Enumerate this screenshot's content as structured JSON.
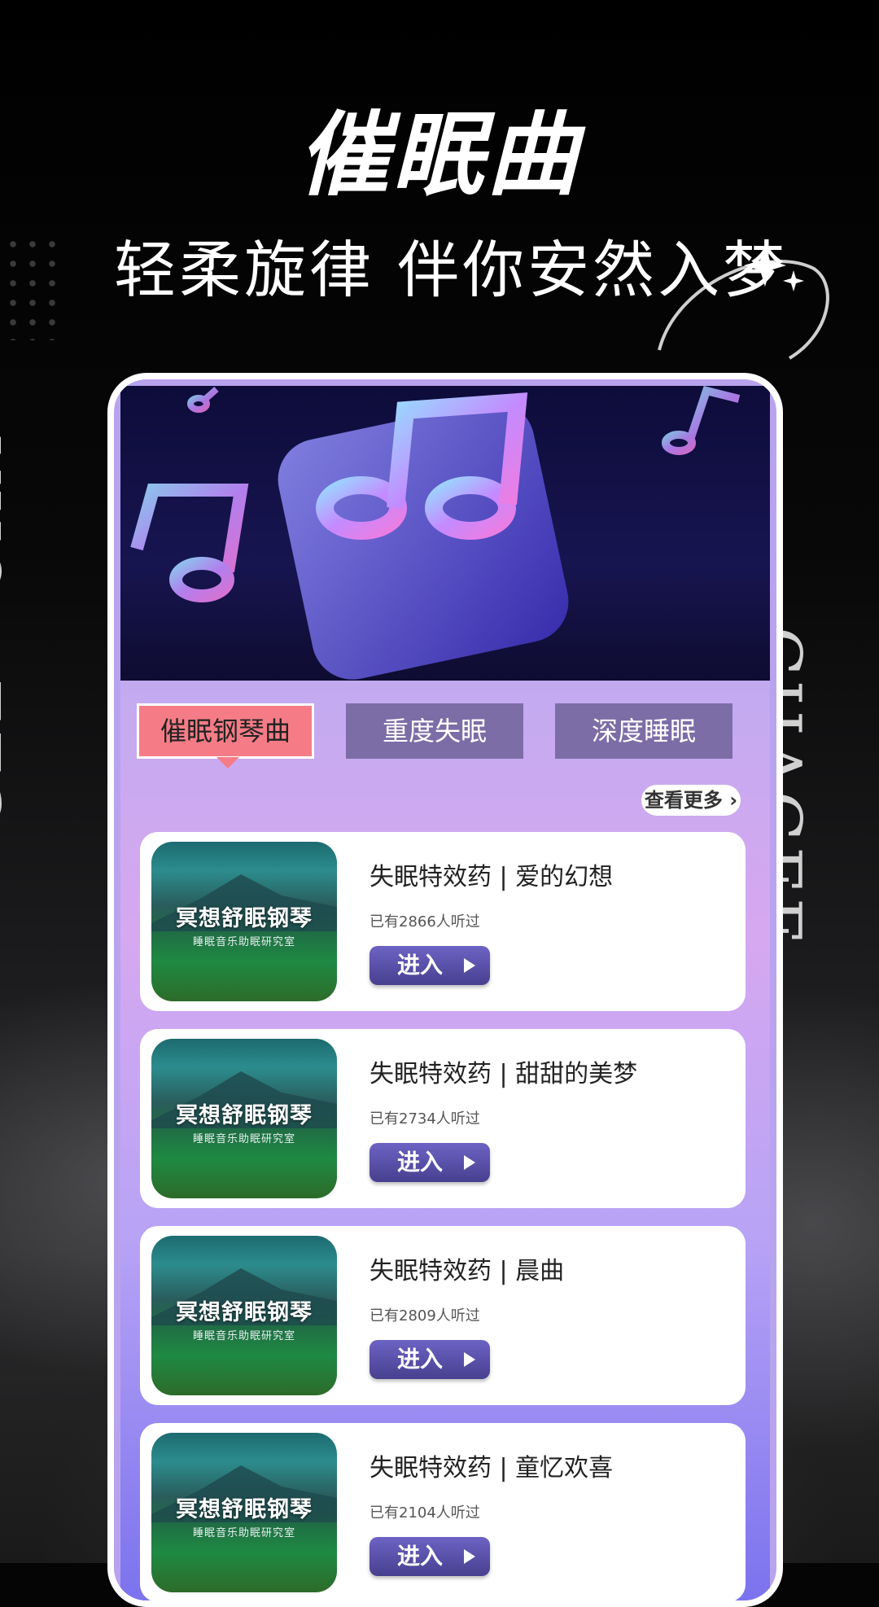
{
  "header": {
    "title": "催眠曲",
    "subtitle": "轻柔旋律 伴你安然入梦"
  },
  "side_text": {
    "left": "GEE · CHA",
    "right": "CHAGEE"
  },
  "tabs": [
    {
      "label": "催眠钢琴曲",
      "active": true
    },
    {
      "label": "重度失眠",
      "active": false
    },
    {
      "label": "深度睡眠",
      "active": false
    }
  ],
  "more_label": "查看更多",
  "thumb": {
    "title": "冥想舒眠钢琴",
    "subtitle": "睡眠音乐助眠研究室"
  },
  "cards": [
    {
      "title": "失眠特效药 | 爱的幻想",
      "count": "已有2866人听过",
      "button": "进入"
    },
    {
      "title": "失眠特效药 | 甜甜的美梦",
      "count": "已有2734人听过",
      "button": "进入"
    },
    {
      "title": "失眠特效药 | 晨曲",
      "count": "已有2809人听过",
      "button": "进入"
    },
    {
      "title": "失眠特效药 | 童忆欢喜",
      "count": "已有2104人听过",
      "button": "进入"
    }
  ],
  "colors": {
    "active_tab": "#f57c86",
    "inactive_tab": "#7c6da7",
    "enter_button": "#5a52ad"
  }
}
